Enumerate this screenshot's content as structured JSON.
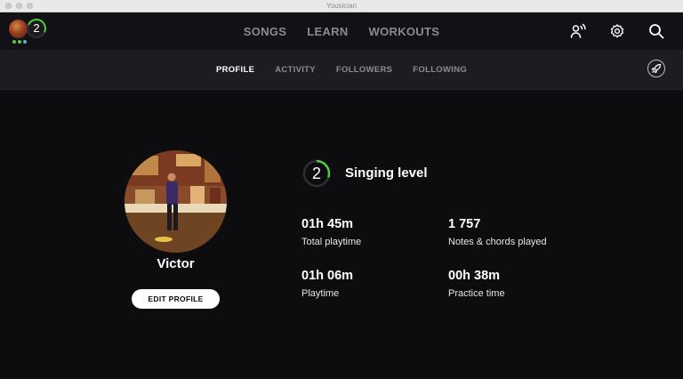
{
  "window": {
    "title": "Yousician"
  },
  "user": {
    "level": "2",
    "instrument_dots": [
      "#4ccf3a",
      "#4ccf3a",
      "#6fa8dc"
    ]
  },
  "nav": {
    "items": [
      "SONGS",
      "LEARN",
      "WORKOUTS"
    ]
  },
  "icons": {
    "friends": "person-voice-icon",
    "settings": "gear-icon",
    "search": "search-icon",
    "boost": "rocket-icon"
  },
  "subnav": {
    "tabs": [
      "PROFILE",
      "ACTIVITY",
      "FOLLOWERS",
      "FOLLOWING"
    ],
    "active": "PROFILE"
  },
  "profile": {
    "name": "Victor",
    "edit_label": "EDIT PROFILE",
    "level": "2",
    "level_progress": 0.3,
    "level_title": "Singing level",
    "stats": [
      {
        "value": "01h 45m",
        "label": "Total playtime"
      },
      {
        "value": "1 757",
        "label": "Notes & chords played"
      },
      {
        "value": "01h 06m",
        "label": "Playtime"
      },
      {
        "value": "00h 38m",
        "label": "Practice time"
      }
    ]
  },
  "colors": {
    "accent": "#4ccf3a",
    "background": "#0d0d10",
    "subnav_bg": "#1c1c21"
  }
}
